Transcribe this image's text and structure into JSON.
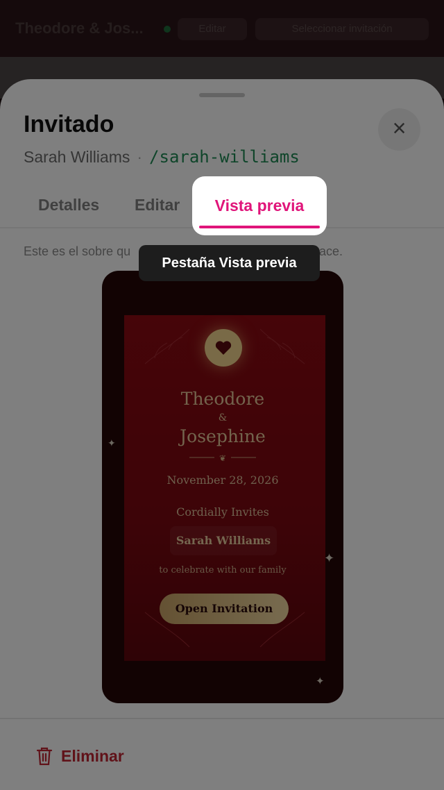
{
  "app_bar": {
    "title": "Theodore & Jos...",
    "edit_label": "Editar",
    "select_label": "Seleccionar invitación"
  },
  "sheet": {
    "title": "Invitado",
    "guest_name": "Sarah Williams",
    "separator": "·",
    "slug": "/sarah-williams",
    "close_icon": "×",
    "tabs": [
      {
        "label": "Detalles",
        "active": false
      },
      {
        "label": "Editar",
        "active": false
      },
      {
        "label": "Vista previa",
        "active": true
      }
    ],
    "info_text": "Este es el sobre qu",
    "info_text_end": "ace.",
    "delete_label": "Eliminar"
  },
  "tooltip": {
    "text": "Pestaña Vista previa"
  },
  "invitation": {
    "name1": "Theodore",
    "ampersand": "&",
    "name2": "Josephine",
    "ornament_glyph": "❦",
    "date": "November 28, 2026",
    "invites_text": "Cordially Invites",
    "guest": "Sarah Williams",
    "celebrate_text": "to celebrate with our family",
    "open_button": "Open Invitation"
  },
  "colors": {
    "accent": "#e0157a",
    "slug": "#1e8a55",
    "delete": "#c12432",
    "card": "#8c0a12",
    "gold": "#e6c99a"
  }
}
